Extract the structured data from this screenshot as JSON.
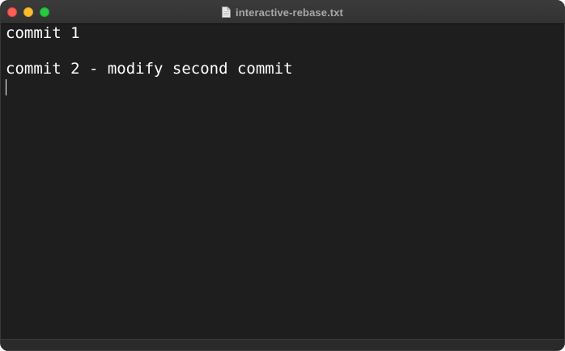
{
  "window": {
    "title": "interactive-rebase.txt",
    "file_icon": "document-icon"
  },
  "editor": {
    "lines": [
      "commit 1",
      "",
      "commit 2 - modify second commit"
    ]
  },
  "colors": {
    "background": "#1e1e1e",
    "text": "#ffffff",
    "titlebar": "#363636",
    "close": "#fe5f57",
    "minimize": "#febc2e",
    "zoom": "#28c840"
  }
}
